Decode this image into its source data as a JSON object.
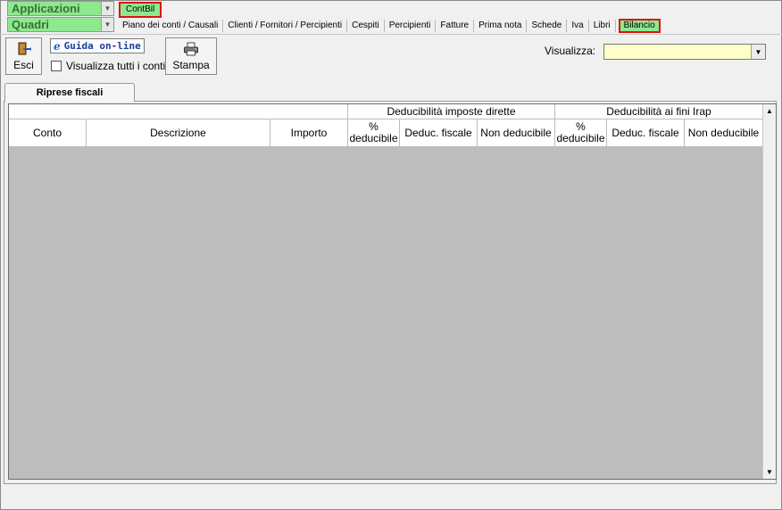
{
  "header": {
    "applicazioni_label": "Applicazioni",
    "quadri_label": "Quadri",
    "app_name": "ContBil",
    "modules": [
      {
        "label": "Piano dei conti / Causali",
        "active": false
      },
      {
        "label": "Clienti / Fornitori / Percipienti",
        "active": false
      },
      {
        "label": "Cespiti",
        "active": false
      },
      {
        "label": "Percipienti",
        "active": false
      },
      {
        "label": "Fatture",
        "active": false
      },
      {
        "label": "Prima nota",
        "active": false
      },
      {
        "label": "Schede",
        "active": false
      },
      {
        "label": "Iva",
        "active": false
      },
      {
        "label": "Libri",
        "active": false
      },
      {
        "label": "Bilancio",
        "active": true
      }
    ]
  },
  "toolbar": {
    "esci_label": "Esci",
    "guida_label": "Guida on-line",
    "visualizza_tutti_label": "Visualizza tutti i conti",
    "visualizza_tutti_checked": false,
    "stampa_label": "Stampa",
    "visualizza_label": "Visualizza:",
    "visualizza_value": ""
  },
  "tabs": [
    {
      "label": "Riprese fiscali",
      "active": true
    }
  ],
  "grid": {
    "group_headers": {
      "imposte_dirette": "Deducibilità imposte dirette",
      "irap": "Deducibilità ai fini Irap"
    },
    "columns": {
      "conto": "Conto",
      "descrizione": "Descrizione",
      "importo": "Importo",
      "perc_deducibile_1": "% deducibile",
      "deduc_fiscale_1": "Deduc. fiscale",
      "non_deducibile_1": "Non deducibile",
      "perc_deducibile_2": "% deducibile",
      "deduc_fiscale_2": "Deduc. fiscale",
      "non_deducibile_2": "Non deducibile"
    },
    "rows": []
  },
  "colors": {
    "green_highlight": "#8ee88e",
    "red_outline": "#dd1111",
    "select_bg": "#ffffc8",
    "grid_empty": "#bdbdbd"
  }
}
